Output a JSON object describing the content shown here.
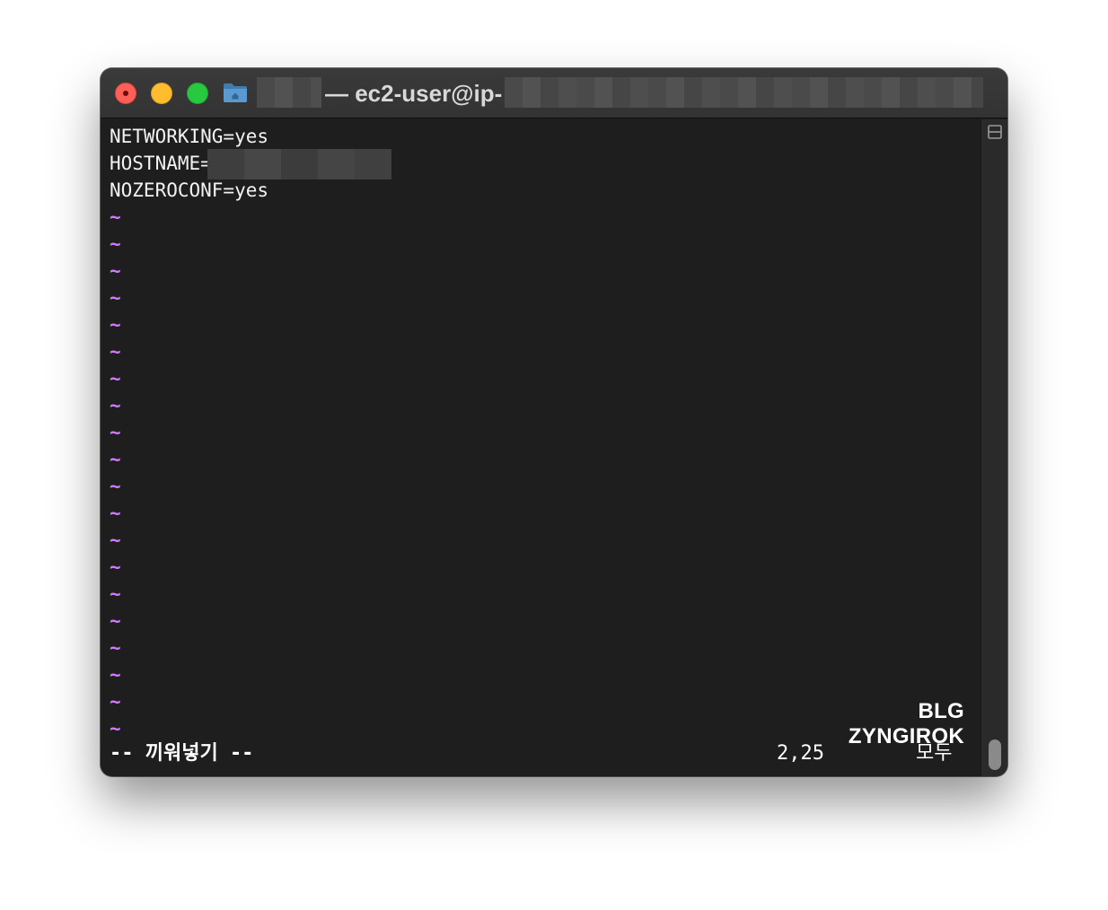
{
  "window": {
    "title": "— ec2-user@ip-"
  },
  "icons": {
    "folder": "folder-icon",
    "split": "split-pane-icon"
  },
  "editor": {
    "lines": [
      {
        "text": "NETWORKING=yes"
      },
      {
        "text": "HOSTNAME="
      },
      {
        "text": "NOZEROCONF=yes"
      }
    ],
    "empty_marker": "~",
    "empty_line_count": 20
  },
  "status": {
    "mode": "-- 끼워넣기 --",
    "position": "2,25",
    "scroll": "모두"
  },
  "watermark": "BLG ZYNGIROK",
  "colors": {
    "tilde": "#d479ff",
    "background": "#1e1e1e",
    "close": "#fe5f57",
    "minimize": "#febc2e",
    "zoom": "#28c840"
  }
}
